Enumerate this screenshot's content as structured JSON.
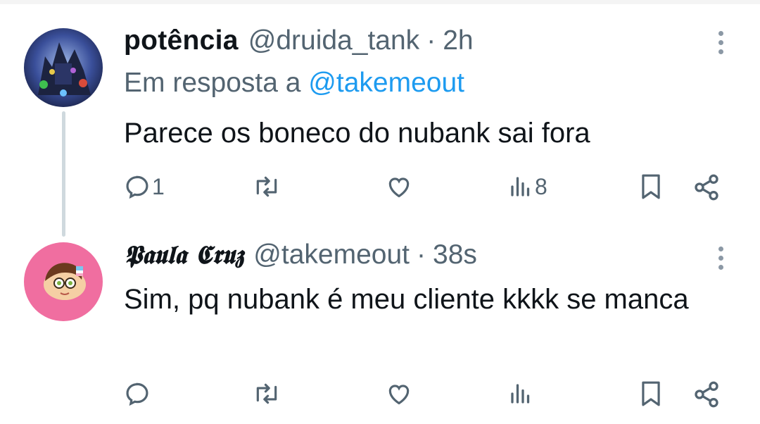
{
  "tweets": [
    {
      "display_name": "potência",
      "handle": "@druida_tank",
      "separator": "·",
      "time": "2h",
      "reply_prefix": "Em resposta a",
      "reply_mention": "@takemeout",
      "text": "Parece os boneco do nubank sai fora",
      "counts": {
        "replies": "1",
        "reposts": "",
        "likes": "",
        "views": "8"
      }
    },
    {
      "display_name": "𝕻𝖆𝖚𝖑𝖆 𝕮𝖗𝖚𝖟",
      "handle": "@takemeout",
      "separator": "·",
      "time": "38s",
      "text": "Sim, pq nubank é meu cliente kkkk se manca",
      "counts": {
        "replies": "",
        "reposts": "",
        "likes": "",
        "views": ""
      }
    }
  ],
  "icons": [
    "reply-icon",
    "repost-icon",
    "like-icon",
    "views-icon",
    "bookmark-icon",
    "share-icon",
    "more-icon"
  ],
  "colors": {
    "text": "#0f1419",
    "secondary": "#536471",
    "link": "#1d9bf0",
    "thread_line": "#cfd9de",
    "avatar2_bg": "#f06ea0"
  }
}
